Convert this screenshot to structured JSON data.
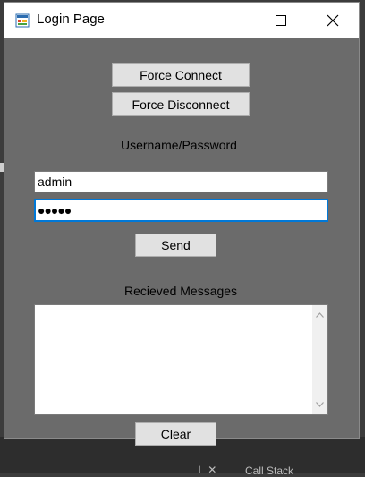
{
  "window": {
    "title": "Login Page",
    "icon": "app-form-icon",
    "controls": {
      "minimize": "minimize-icon",
      "maximize": "maximize-icon",
      "close": "close-icon"
    }
  },
  "connection": {
    "force_connect_label": "Force Connect",
    "force_disconnect_label": "Force Disconnect"
  },
  "login": {
    "heading": "Username/Password",
    "username_value": "admin",
    "password_value": "●●●●●",
    "send_label": "Send"
  },
  "messages": {
    "heading": "Recieved Messages",
    "content": "",
    "clear_label": "Clear"
  },
  "background": {
    "bottom_text": "Call Stack",
    "bottom_icons": "⊥ ✕"
  },
  "colors": {
    "window_bg": "#6b6b6b",
    "focus_border": "#0078d7",
    "button_bg": "#e1e1e1"
  }
}
